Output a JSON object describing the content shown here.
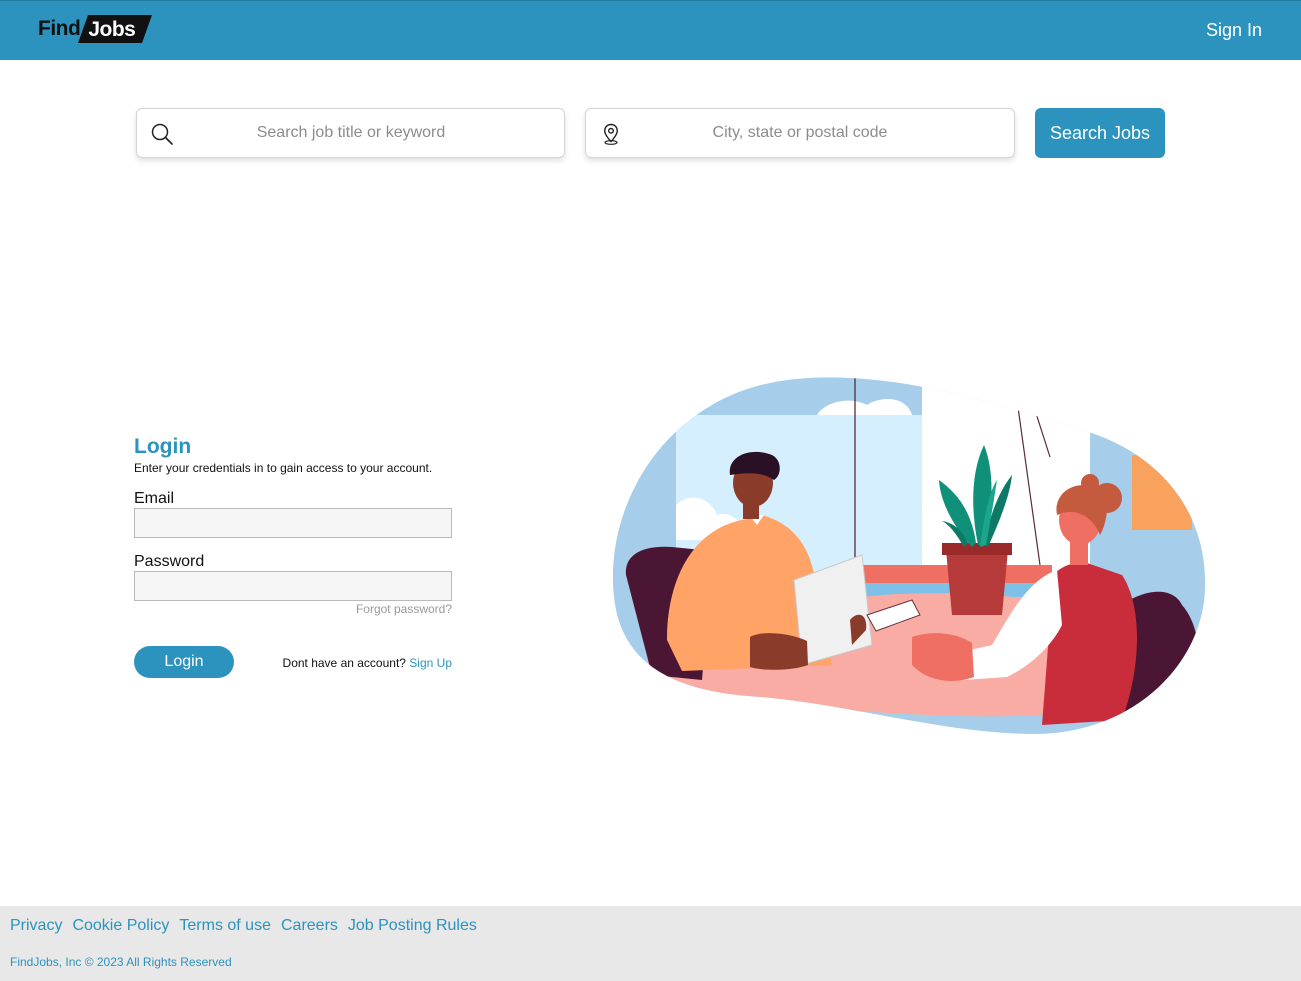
{
  "header": {
    "logo_find": "Find",
    "logo_jobs": "Jobs",
    "sign_in": "Sign In"
  },
  "search": {
    "keyword_placeholder": "Search job title or keyword",
    "location_placeholder": "City, state or postal code",
    "button": "Search Jobs"
  },
  "login": {
    "title": "Login",
    "subtitle": "Enter your credentials in to gain access to your account.",
    "email_label": "Email",
    "email_value": "",
    "password_label": "Password",
    "password_value": "",
    "forgot": "Forgot password?",
    "button": "Login",
    "no_account": "Dont have an account?",
    "sign_up": "Sign Up"
  },
  "footer": {
    "links": [
      "Privacy",
      "Cookie Policy",
      "Terms of use",
      "Careers",
      "Job Posting Rules"
    ],
    "copyright": "FindJobs, Inc © 2023 All Rights Reserved"
  },
  "colors": {
    "brand": "#2b93bd",
    "footer_bg": "#e8e8e8"
  },
  "icons": [
    "search-icon",
    "location-pin-icon"
  ]
}
